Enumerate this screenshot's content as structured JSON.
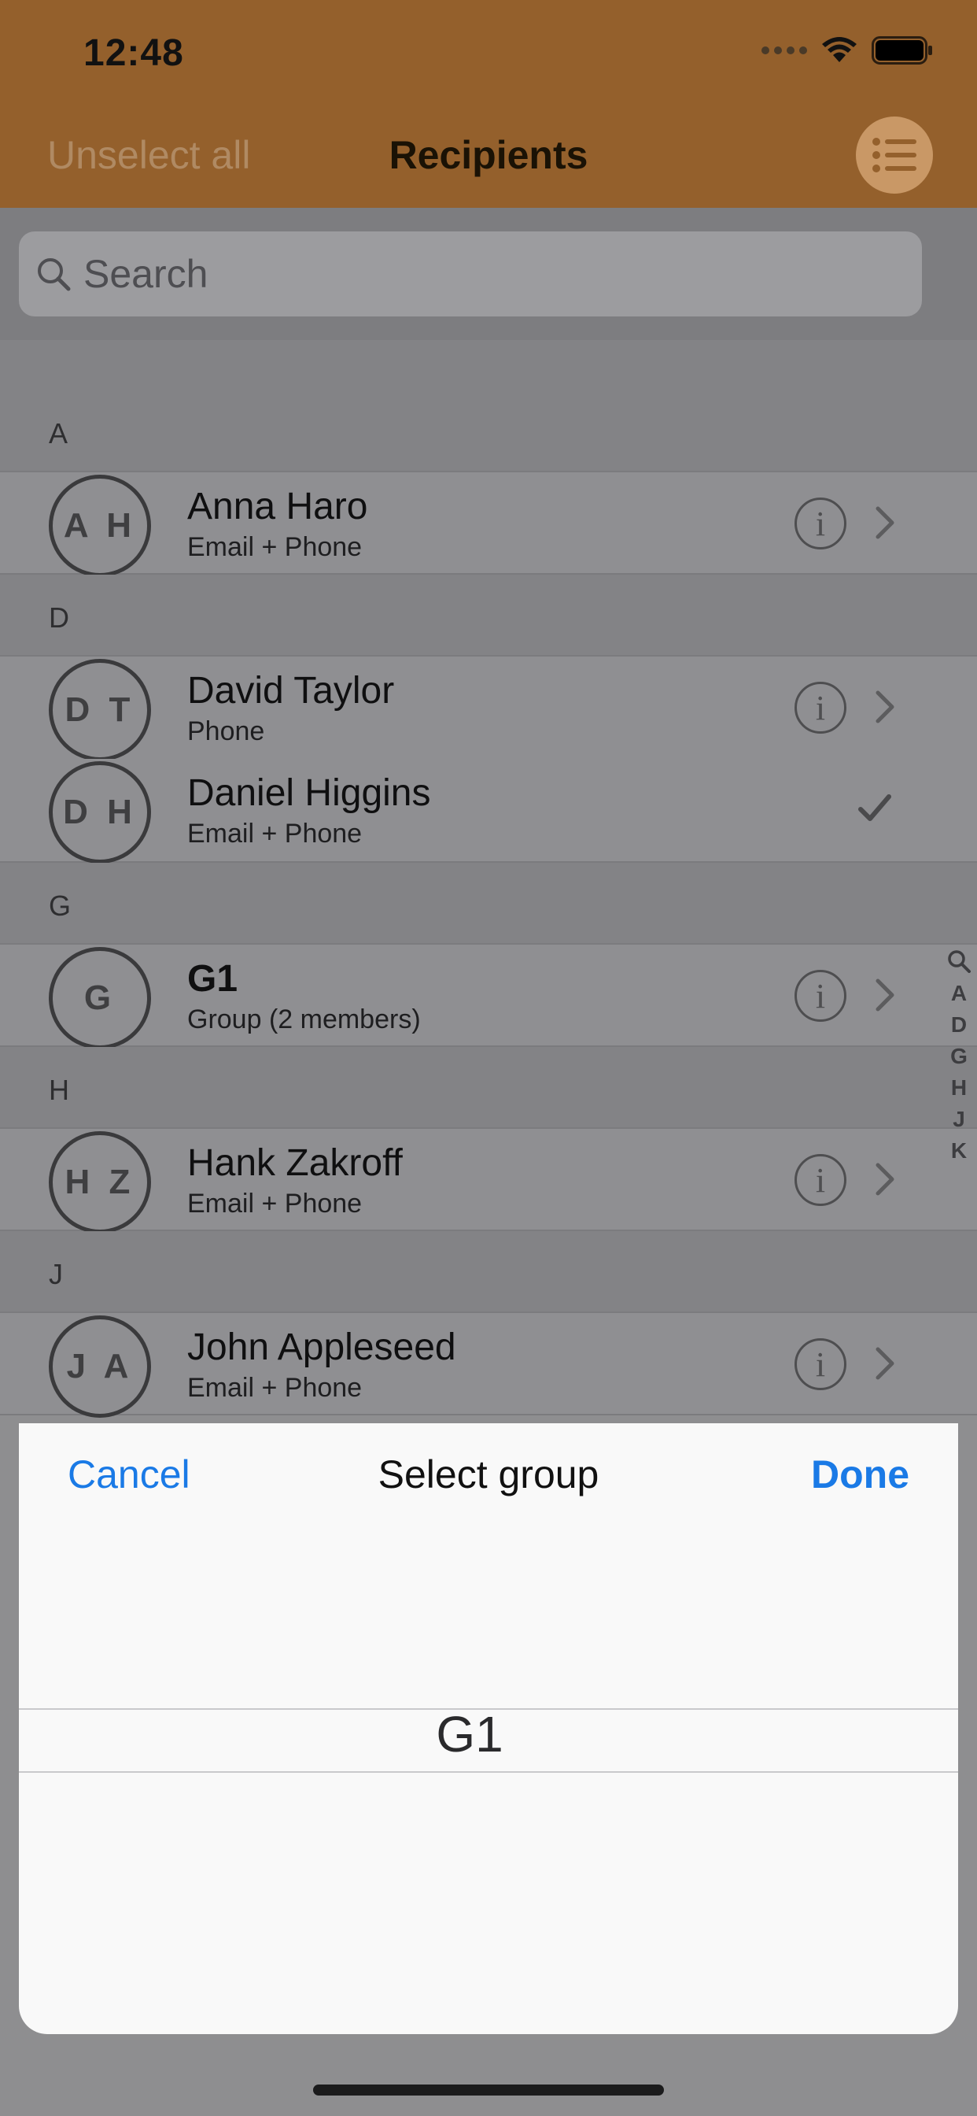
{
  "status_bar": {
    "time": "12:48"
  },
  "nav": {
    "left_button": "Unselect all",
    "title": "Recipients"
  },
  "search": {
    "placeholder": "Search"
  },
  "sections": [
    {
      "letter": "A",
      "contacts": [
        {
          "initials": "A H",
          "name": "Anna Haro",
          "detail": "Email + Phone",
          "state": "info"
        }
      ]
    },
    {
      "letter": "D",
      "contacts": [
        {
          "initials": "D T",
          "name": "David Taylor",
          "detail": "Phone",
          "state": "info"
        },
        {
          "initials": "D H",
          "name": "Daniel Higgins",
          "detail": "Email + Phone",
          "state": "checked"
        }
      ]
    },
    {
      "letter": "G",
      "contacts": [
        {
          "initials": "G",
          "name": "G1",
          "detail": "Group (2 members)",
          "state": "info"
        }
      ]
    },
    {
      "letter": "H",
      "contacts": [
        {
          "initials": "H Z",
          "name": "Hank Zakroff",
          "detail": "Email + Phone",
          "state": "info"
        }
      ]
    },
    {
      "letter": "J",
      "contacts": [
        {
          "initials": "J A",
          "name": "John Appleseed",
          "detail": "Email + Phone",
          "state": "info"
        }
      ]
    }
  ],
  "index": [
    "A",
    "D",
    "G",
    "H",
    "J",
    "K"
  ],
  "sheet": {
    "cancel": "Cancel",
    "title": "Select group",
    "done": "Done",
    "selected": "G1"
  }
}
